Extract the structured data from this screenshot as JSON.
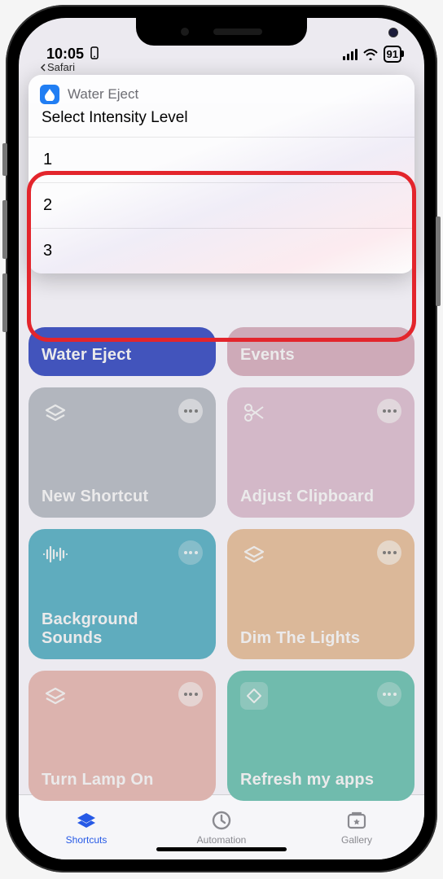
{
  "status": {
    "time": "10:05",
    "back_app": "Safari",
    "battery": "91"
  },
  "modal": {
    "title": "Water Eject",
    "subtitle": "Select Intensity Level",
    "options": [
      "1",
      "2",
      "3"
    ]
  },
  "tiles": [
    {
      "label": "Water Eject",
      "icon": "drop-icon",
      "color": "t-blue"
    },
    {
      "label": "Events",
      "icon": "text-icon",
      "color": "t-pink"
    },
    {
      "label": "New Shortcut",
      "icon": "stack-icon",
      "color": "t-grey"
    },
    {
      "label": "Adjust Clipboard",
      "icon": "scissors-icon",
      "color": "t-lpink"
    },
    {
      "label": "Background Sounds",
      "icon": "sound-icon",
      "color": "t-cyan"
    },
    {
      "label": "Dim The Lights",
      "icon": "stack-icon",
      "color": "t-peach"
    },
    {
      "label": "Turn Lamp On",
      "icon": "stack-icon",
      "color": "t-lpeach"
    },
    {
      "label": "Refresh my apps",
      "icon": "diamond-icon",
      "color": "t-teal"
    }
  ],
  "tabs": {
    "shortcuts": "Shortcuts",
    "automation": "Automation",
    "gallery": "Gallery"
  }
}
